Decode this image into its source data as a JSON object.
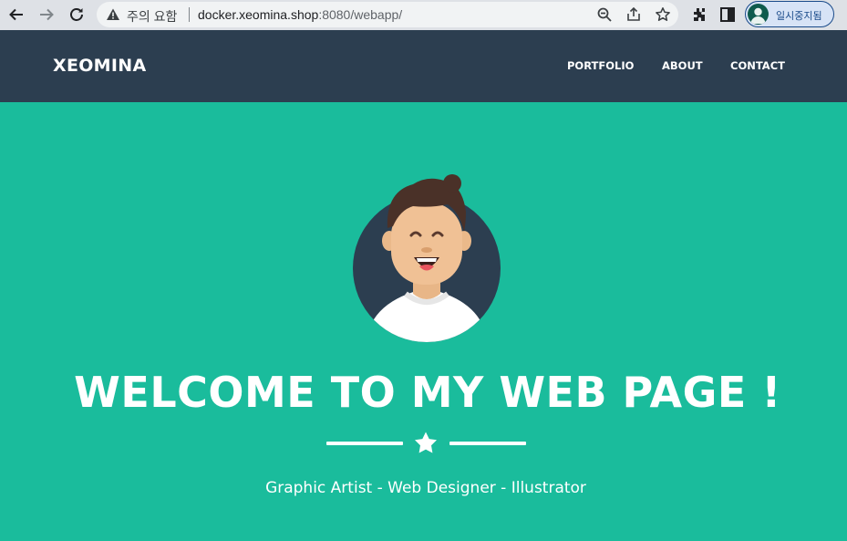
{
  "browser": {
    "security_label": "주의 요함",
    "url_host": "docker.xeomina.shop",
    "url_rest": ":8080/webapp/",
    "profile_label": "일시중지됨",
    "icons": [
      "back-icon",
      "forward-icon",
      "reload-icon",
      "warning-icon",
      "zoom-icon",
      "share-icon",
      "star-icon",
      "extensions-icon",
      "side-panel-icon",
      "profile-icon"
    ]
  },
  "site": {
    "brand": "XEOMINA",
    "nav": {
      "portfolio": "PORTFOLIO",
      "about": "ABOUT",
      "contact": "CONTACT"
    }
  },
  "hero": {
    "title": "WELCOME TO MY WEB PAGE !",
    "subtitle": "Graphic Artist - Web Designer - Illustrator",
    "divider_icon": "star-icon"
  },
  "colors": {
    "navbar": "#2c3e50",
    "hero_bg": "#1abc9c",
    "text": "#ffffff"
  }
}
